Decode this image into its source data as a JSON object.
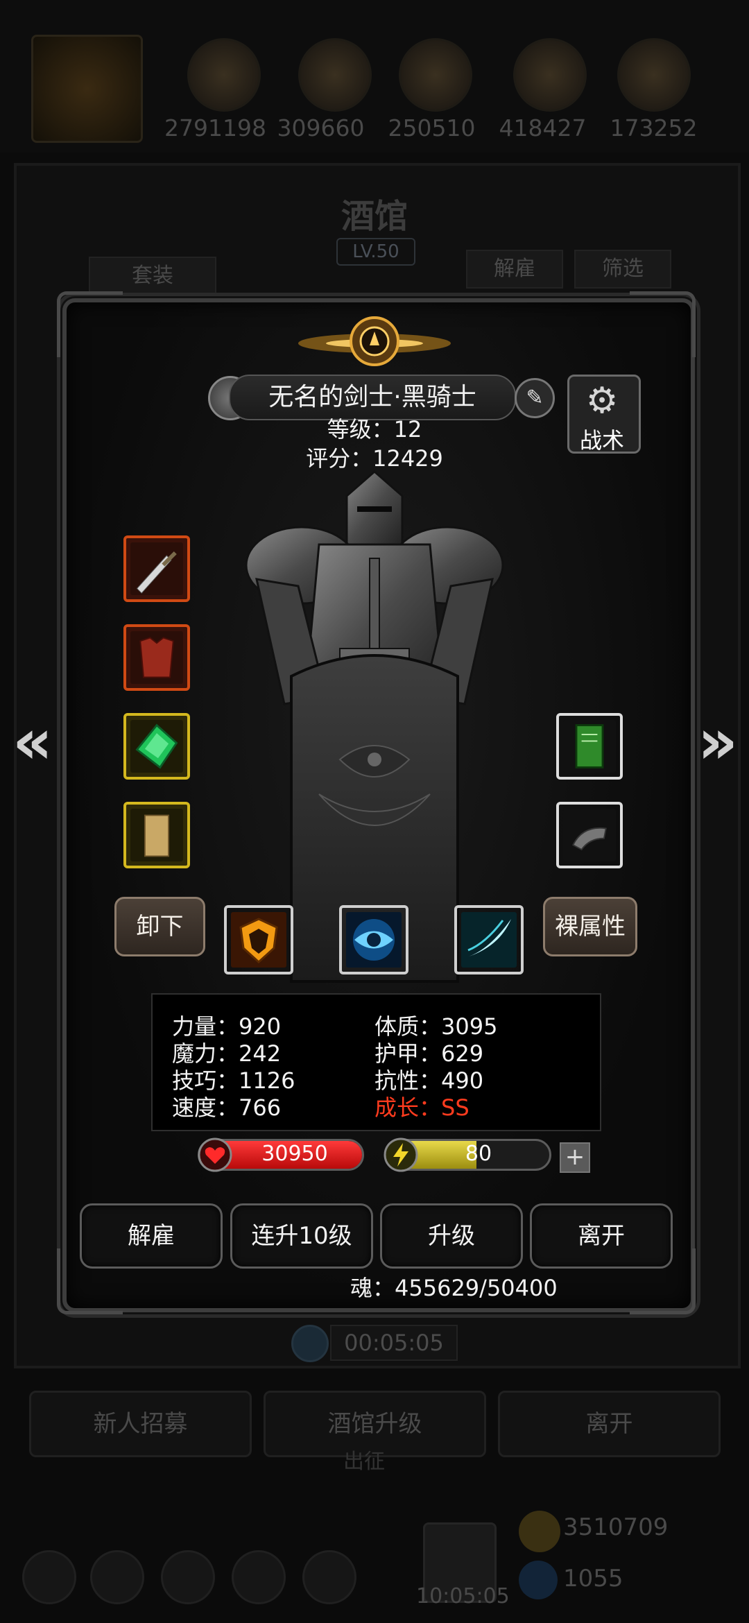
{
  "background": {
    "resources": [
      "2791198",
      "309660",
      "250510",
      "418427",
      "173252"
    ],
    "title": "酒馆",
    "level": "LV.50",
    "btn_set": "套装",
    "btn_dismiss": "解雇",
    "btn_filter": "筛选",
    "timer": "00:05:05",
    "btn_recruit": "新人招募",
    "btn_upgrade_tavern": "酒馆升级",
    "btn_leave": "离开",
    "expedition": "出征",
    "gold": "3510709",
    "gems": "1055",
    "clock": "10:05:05"
  },
  "hero": {
    "name": "无名的剑士·黑骑士",
    "level_label": "等级：12",
    "score_label": "评分：12429",
    "tactics_label": "战术",
    "unequip_label": "卸下",
    "bare_stats_label": "裸属性",
    "stats": {
      "strength": "力量：920",
      "magic": "魔力：242",
      "skill": "技巧：1126",
      "speed": "速度：766",
      "constitution": "体质：3095",
      "armor": "护甲：629",
      "resistance": "抗性：490",
      "growth": "成长：SS"
    },
    "hp": "30950",
    "energy": "80",
    "energy_fill": 0.55,
    "plus": "+",
    "actions": {
      "dismiss": "解雇",
      "upgrade10": "连升10级",
      "upgrade": "升级",
      "leave": "离开"
    },
    "soul": "魂：455629/50400"
  },
  "icons": {
    "left_arrow": "«",
    "right_arrow": "»",
    "gear": "⚙",
    "edit": "✎"
  }
}
